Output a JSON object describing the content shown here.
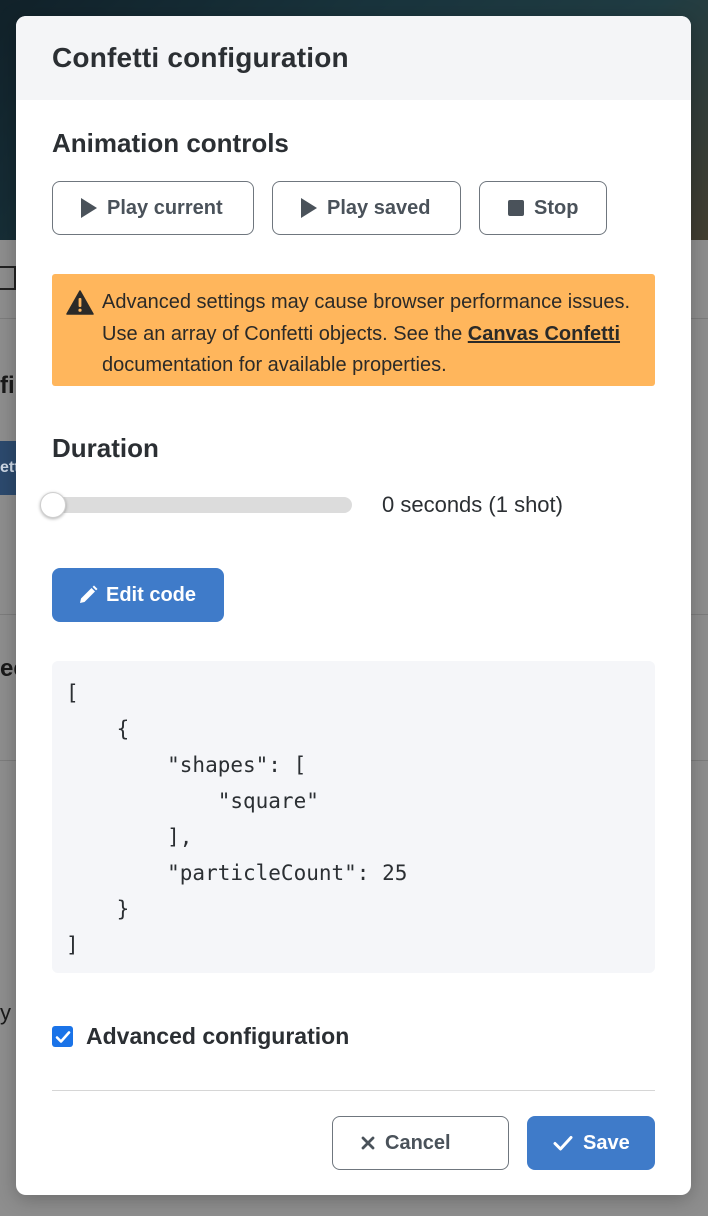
{
  "modal": {
    "title": "Confetti configuration"
  },
  "animation": {
    "title": "Animation controls",
    "buttons": {
      "play_current": "Play current",
      "play_saved": "Play saved",
      "stop": "Stop"
    }
  },
  "alert": {
    "text_before": "Advanced settings may cause browser performance issues. Use an array of Confetti objects. See the ",
    "link_text": "Canvas Confetti",
    "text_after": " documentation for available properties."
  },
  "duration": {
    "title": "Duration",
    "value_seconds": 0,
    "value_label": "0 seconds (1 shot)"
  },
  "edit_button": "Edit code",
  "code": "[\n    {\n        \"shapes\": [\n            \"square\"\n        ],\n        \"particleCount\": 25\n    }\n]",
  "advanced": {
    "label": "Advanced configuration",
    "checked": true
  },
  "footer": {
    "cancel": "Cancel",
    "save": "Save"
  },
  "colors": {
    "primary": "#3f7bc9",
    "warning": "#ffb65c",
    "checkbox": "#1a73e8"
  },
  "background": {
    "fragments": [
      "fi",
      "ett",
      "ee",
      "y v"
    ]
  }
}
